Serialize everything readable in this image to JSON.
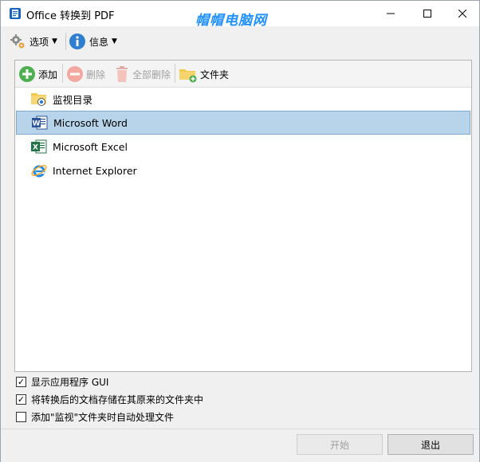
{
  "window": {
    "title": "Office 转换到 PDF",
    "watermark": "帽帽电脑网"
  },
  "menu": {
    "options_label": "选项",
    "info_label": "信息"
  },
  "toolbar": {
    "add_label": "添加",
    "delete_label": "删除",
    "delete_all_label": "全部删除",
    "folder_label": "文件夹"
  },
  "list": {
    "items": [
      {
        "label": "监视目录",
        "icon": "watch-folder-icon"
      },
      {
        "label": "Microsoft Word",
        "icon": "word-icon",
        "selected": true
      },
      {
        "label": "Microsoft Excel",
        "icon": "excel-icon"
      },
      {
        "label": "Internet Explorer",
        "icon": "ie-icon"
      }
    ]
  },
  "options": {
    "items": [
      {
        "label": "显示应用程序 GUI",
        "checked": true
      },
      {
        "label": "将转换后的文档存储在其原来的文件夹中",
        "checked": true
      },
      {
        "label": "添加\"监视\"文件夹时自动处理文件",
        "checked": false
      }
    ]
  },
  "buttons": {
    "start_label": "开始",
    "exit_label": "退出"
  },
  "colors": {
    "selection": "#b8d4ea",
    "accent": "#1e90ff"
  }
}
